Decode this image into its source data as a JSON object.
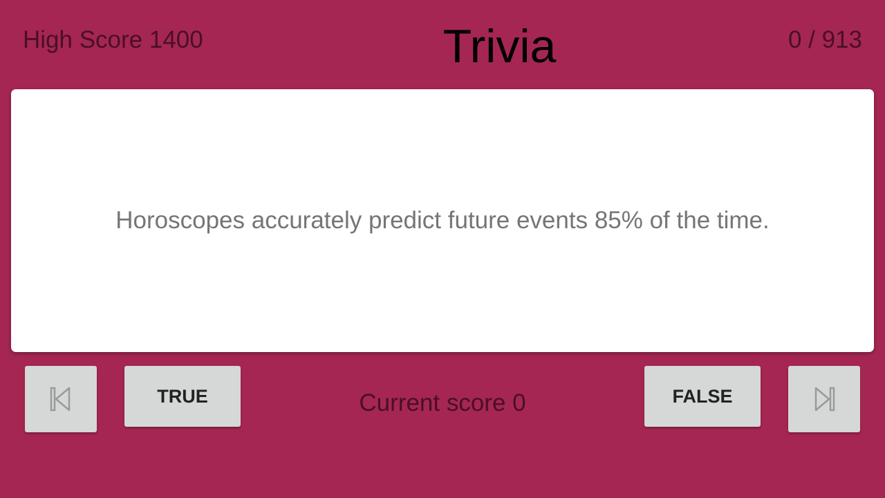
{
  "header": {
    "high_score": "High Score 1400",
    "title": "Trivia",
    "progress": "0 / 913"
  },
  "card": {
    "question": "Horoscopes accurately predict future events 85% of the time."
  },
  "controls": {
    "prev_icon": "skip-previous-icon",
    "true_label": "TRUE",
    "current_score": "Current score 0",
    "false_label": "FALSE",
    "next_icon": "skip-next-icon"
  },
  "colors": {
    "background": "#A52653",
    "header_text": "#4A0F26",
    "button": "#D6D7D7",
    "question_text": "#757575"
  }
}
